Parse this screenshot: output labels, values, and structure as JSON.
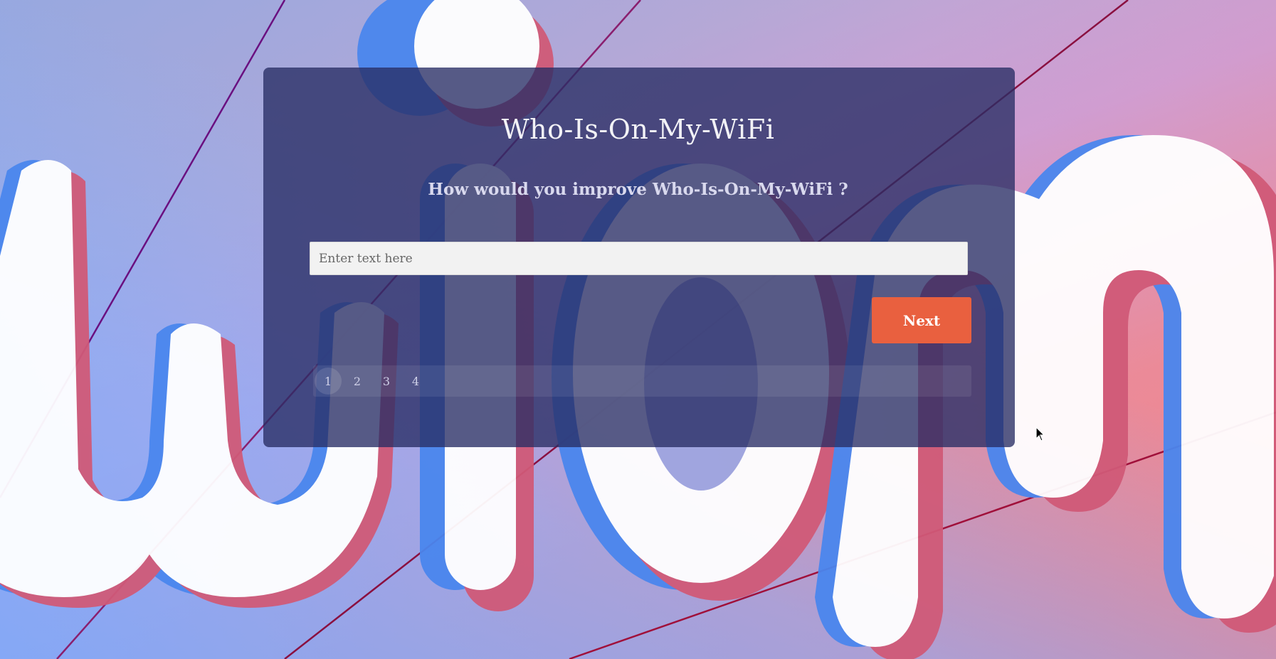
{
  "app": {
    "title": "Who-Is-On-My-WiFi"
  },
  "survey": {
    "question": "How would you improve Who-Is-On-My-WiFi ?",
    "input_placeholder": "Enter text here",
    "input_value": "",
    "next_label": "Next",
    "pages": [
      "1",
      "2",
      "3",
      "4"
    ],
    "active_page": "1"
  },
  "colors": {
    "accent": "#e9603f",
    "card": "#2d3264",
    "input_bg": "#f2f2f2"
  }
}
